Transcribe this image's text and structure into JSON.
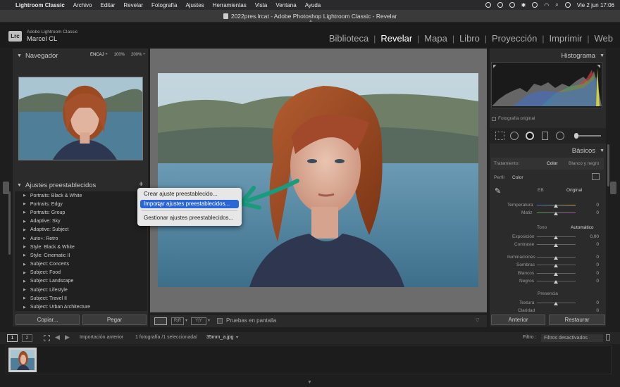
{
  "menubar": {
    "app": "Lightroom Classic",
    "items": [
      "Archivo",
      "Editar",
      "Revelar",
      "Fotografía",
      "Ajustes",
      "Herramientas",
      "Vista",
      "Ventana",
      "Ayuda"
    ],
    "clock": "Vie 2 jun  17:06"
  },
  "window": {
    "title": "2022pres.lrcat - Adobe Photoshop Lightroom Classic - Revelar"
  },
  "identity": {
    "logo": "Lrc",
    "line1": "Adobe Lightroom Classic",
    "line2": "Marcel CL"
  },
  "modules": [
    "Biblioteca",
    "Revelar",
    "Mapa",
    "Libro",
    "Proyección",
    "Imprimir",
    "Web"
  ],
  "active_module": "Revelar",
  "navigator": {
    "title": "Navegador",
    "zoom_options": [
      "ENCAJ ÷",
      "100%",
      "200% ÷"
    ]
  },
  "presets": {
    "title": "Ajustes preestablecidos",
    "add_symbol": "+",
    "items": [
      "Portraits: Black & White",
      "Portraits: Edgy",
      "Portraits: Group",
      "Adaptive: Sky",
      "Adaptive: Subject",
      "Auto+: Retro",
      "Style: Black & White",
      "Style: Cinematic II",
      "Subject: Concerts",
      "Subject: Food",
      "Subject: Landscape",
      "Subject: Lifestyle",
      "Subject: Travel II",
      "Subject: Urban Architecture"
    ]
  },
  "left_buttons": {
    "copy": "Copiar...",
    "paste": "Pegar"
  },
  "context_menu": {
    "items": [
      "Crear ajuste preestablecido...",
      "Importar ajustes preestablecidos...",
      "Gestionar ajustes preestablecidos..."
    ],
    "highlighted_index": 1
  },
  "toolbar": {
    "soft_proof": "Pruebas en pantalla"
  },
  "right": {
    "histogram_title": "Histograma",
    "original_photo": "Fotografía original",
    "basics_title": "Básicos",
    "treatment_label": "Tratamiento:",
    "treatment_color": "Color",
    "treatment_bw": "Blanco y negro",
    "profile_label": "Perfil",
    "profile_value": "Color",
    "wb_label": "EB",
    "wb_value": "Original",
    "temp_label": "Temperatura",
    "temp_value": "0",
    "tint_label": "Matiz",
    "tint_value": "0",
    "tone_label": "Tono",
    "tone_auto": "Automático",
    "exposure_label": "Exposición",
    "exposure_value": "0,00",
    "contrast_label": "Contraste",
    "contrast_value": "0",
    "highlights_label": "Iluminaciones",
    "highlights_value": "0",
    "shadows_label": "Sombras",
    "shadows_value": "0",
    "whites_label": "Blancos",
    "whites_value": "0",
    "blacks_label": "Negros",
    "blacks_value": "0",
    "presence_label": "Presencia",
    "texture_label": "Textura",
    "texture_value": "0",
    "clarity_label": "Claridad",
    "clarity_value": "0",
    "prev_button": "Anterior",
    "reset_button": "Restaurar"
  },
  "filmstrip": {
    "page1": "1",
    "page2": "2",
    "source": "Importación anterior",
    "info": "1 fotografía /1 seleccionada/",
    "filename": "35mm_a.jpg",
    "filter_label": "Filtro :",
    "filter_value": "Filtros desactivados"
  },
  "colors": {
    "accent": "#2a66d6",
    "arrow": "#1b9b7e",
    "bg": "#1e1e1e",
    "panel": "#2b2b2b"
  }
}
